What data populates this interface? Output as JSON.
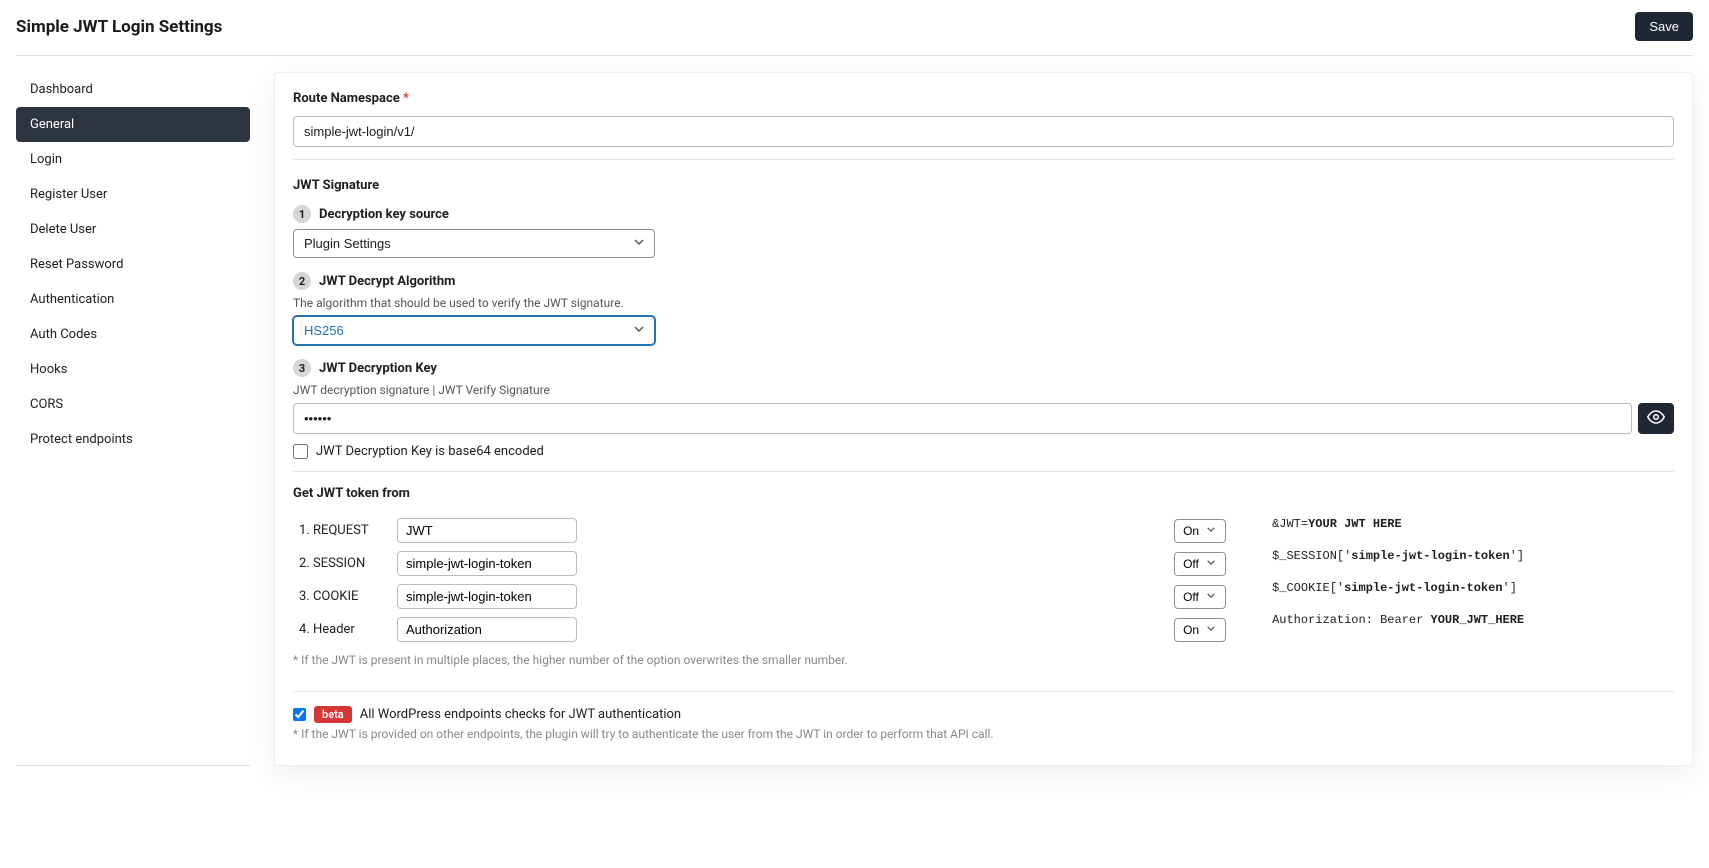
{
  "header": {
    "title": "Simple JWT Login Settings",
    "save_label": "Save"
  },
  "sidebar": {
    "items": [
      {
        "label": "Dashboard"
      },
      {
        "label": "General"
      },
      {
        "label": "Login"
      },
      {
        "label": "Register User"
      },
      {
        "label": "Delete User"
      },
      {
        "label": "Reset Password"
      },
      {
        "label": "Authentication"
      },
      {
        "label": "Auth Codes"
      },
      {
        "label": "Hooks"
      },
      {
        "label": "CORS"
      },
      {
        "label": "Protect endpoints"
      }
    ],
    "active_index": 1
  },
  "route": {
    "label": "Route Namespace",
    "required": "*",
    "value": "simple-jwt-login/v1/"
  },
  "signature": {
    "heading": "JWT Signature",
    "step1_num": "1",
    "step1_label": "Decryption key source",
    "key_source_value": "Plugin Settings",
    "step2_num": "2",
    "step2_label": "JWT Decrypt Algorithm",
    "step2_helper": "The algorithm that should be used to verify the JWT signature.",
    "algorithm_value": "HS256",
    "step3_num": "3",
    "step3_label": "JWT Decryption Key",
    "step3_helper": "JWT decryption signature | JWT Verify Signature",
    "decryption_key_value": "••••••",
    "base64_checkbox_label": "JWT Decryption Key is base64 encoded"
  },
  "token": {
    "heading": "Get JWT token from",
    "rows": [
      {
        "label": "1. REQUEST",
        "value": "JWT",
        "state": "On"
      },
      {
        "label": "2. SESSION",
        "value": "simple-jwt-login-token",
        "state": "Off"
      },
      {
        "label": "3. COOKIE",
        "value": "simple-jwt-login-token",
        "state": "Off"
      },
      {
        "label": "4. Header",
        "value": "Authorization",
        "state": "On"
      }
    ],
    "note": "* If the JWT is present in multiple places, the higher number of the option overwrites the smaller number.",
    "preview": {
      "request_prefix": "&JWT=",
      "request_bold": "YOUR JWT HERE",
      "session_prefix": "$_SESSION['",
      "session_bold": "simple-jwt-login-token",
      "session_suffix": "']",
      "cookie_prefix": "$_COOKIE['",
      "cookie_bold": "simple-jwt-login-token",
      "cookie_suffix": "']",
      "header_prefix": "Authorization: Bearer ",
      "header_bold": "YOUR_JWT_HERE"
    }
  },
  "beta": {
    "badge": "beta",
    "label": "All WordPress endpoints checks for JWT authentication",
    "helper": "* If the JWT is provided on other endpoints, the plugin will try to authenticate the user from the JWT in order to perform that API call."
  }
}
